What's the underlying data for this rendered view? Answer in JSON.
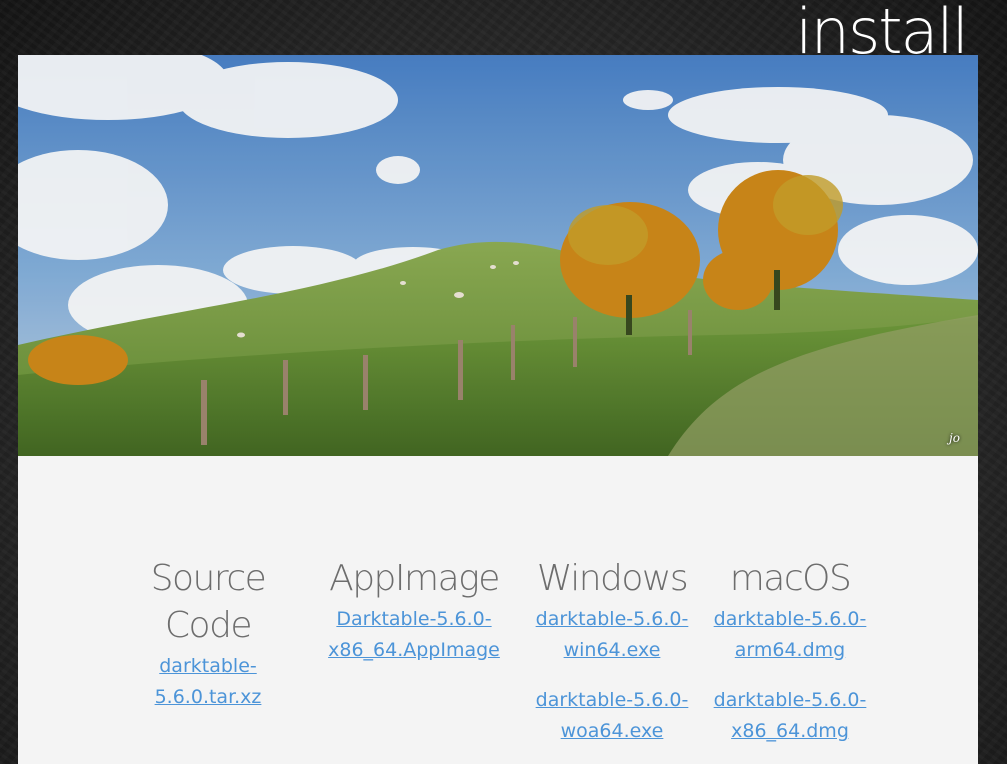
{
  "header": {
    "title": "install"
  },
  "hero": {
    "photo_credit": "jo",
    "alt": "landscape-photo"
  },
  "downloads": {
    "source": {
      "title": "Source Code",
      "files": [
        "darktable-5.6.0.tar.xz"
      ]
    },
    "appimage": {
      "title": "AppImage",
      "files": [
        "Darktable-5.6.0-x86_64.AppImage"
      ]
    },
    "windows": {
      "title": "Windows",
      "files": [
        "darktable-5.6.0-win64.exe",
        "darktable-5.6.0-woa64.exe"
      ]
    },
    "macos": {
      "title": "macOS",
      "files": [
        "darktable-5.6.0-arm64.dmg",
        "darktable-5.6.0-x86_64.dmg"
      ]
    }
  },
  "colors": {
    "link": "#4c94d8",
    "heading": "#6d6d6d",
    "card": "#f4f4f4"
  }
}
